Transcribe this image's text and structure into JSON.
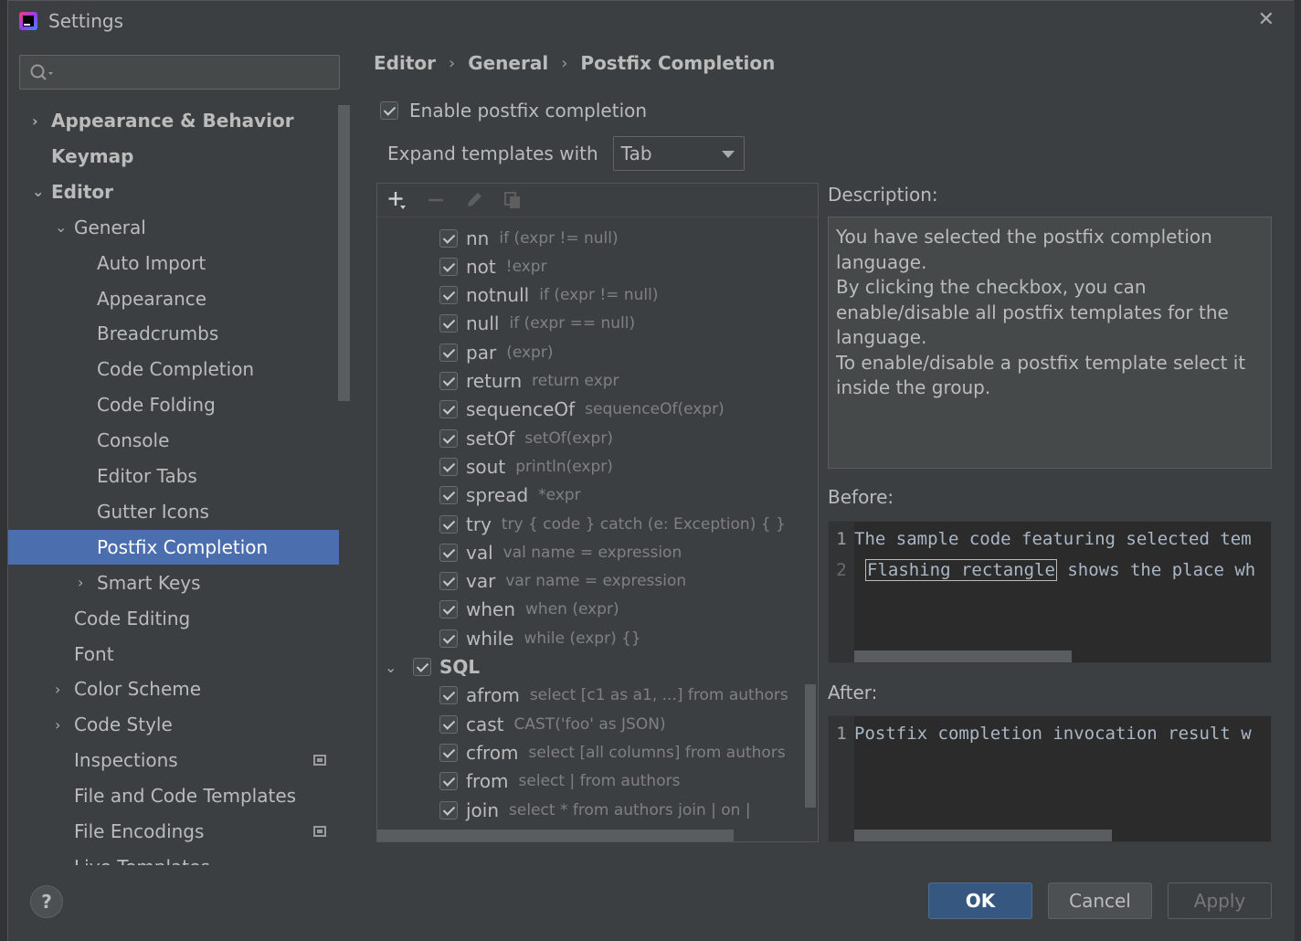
{
  "window": {
    "title": "Settings"
  },
  "search": {
    "placeholder": ""
  },
  "tree": [
    {
      "label": "Appearance & Behavior",
      "bold": true,
      "chevron": "›",
      "indent": 0
    },
    {
      "label": "Keymap",
      "bold": true,
      "chevron": "",
      "indent": 0
    },
    {
      "label": "Editor",
      "bold": true,
      "chevron": "⌄",
      "indent": 0
    },
    {
      "label": "General",
      "bold": false,
      "chevron": "⌄",
      "indent": 1
    },
    {
      "label": "Auto Import",
      "bold": false,
      "chevron": "",
      "indent": 2
    },
    {
      "label": "Appearance",
      "bold": false,
      "chevron": "",
      "indent": 2
    },
    {
      "label": "Breadcrumbs",
      "bold": false,
      "chevron": "",
      "indent": 2
    },
    {
      "label": "Code Completion",
      "bold": false,
      "chevron": "",
      "indent": 2
    },
    {
      "label": "Code Folding",
      "bold": false,
      "chevron": "",
      "indent": 2
    },
    {
      "label": "Console",
      "bold": false,
      "chevron": "",
      "indent": 2
    },
    {
      "label": "Editor Tabs",
      "bold": false,
      "chevron": "",
      "indent": 2
    },
    {
      "label": "Gutter Icons",
      "bold": false,
      "chevron": "",
      "indent": 2
    },
    {
      "label": "Postfix Completion",
      "bold": false,
      "chevron": "",
      "indent": 2,
      "selected": true
    },
    {
      "label": "Smart Keys",
      "bold": false,
      "chevron": "›",
      "indent": 2
    },
    {
      "label": "Code Editing",
      "bold": false,
      "chevron": "",
      "indent": 1
    },
    {
      "label": "Font",
      "bold": false,
      "chevron": "",
      "indent": 1
    },
    {
      "label": "Color Scheme",
      "bold": false,
      "chevron": "›",
      "indent": 1
    },
    {
      "label": "Code Style",
      "bold": false,
      "chevron": "›",
      "indent": 1
    },
    {
      "label": "Inspections",
      "bold": false,
      "chevron": "",
      "indent": 1,
      "project_icon": true
    },
    {
      "label": "File and Code Templates",
      "bold": false,
      "chevron": "",
      "indent": 1
    },
    {
      "label": "File Encodings",
      "bold": false,
      "chevron": "",
      "indent": 1,
      "project_icon": true
    },
    {
      "label": "Live Templates",
      "bold": false,
      "chevron": "",
      "indent": 1
    }
  ],
  "breadcrumb": [
    "Editor",
    "General",
    "Postfix Completion"
  ],
  "enable": {
    "checked": true,
    "label": "Enable postfix completion"
  },
  "expand": {
    "label": "Expand templates with",
    "value": "Tab"
  },
  "templates": [
    {
      "name": "nn",
      "desc": "if (expr != null)",
      "group": false
    },
    {
      "name": "not",
      "desc": "!expr",
      "group": false
    },
    {
      "name": "notnull",
      "desc": "if (expr != null)",
      "group": false
    },
    {
      "name": "null",
      "desc": "if (expr == null)",
      "group": false
    },
    {
      "name": "par",
      "desc": "(expr)",
      "group": false
    },
    {
      "name": "return",
      "desc": "return expr",
      "group": false
    },
    {
      "name": "sequenceOf",
      "desc": "sequenceOf(expr)",
      "group": false
    },
    {
      "name": "setOf",
      "desc": "setOf(expr)",
      "group": false
    },
    {
      "name": "sout",
      "desc": "println(expr)",
      "group": false
    },
    {
      "name": "spread",
      "desc": "*expr",
      "group": false
    },
    {
      "name": "try",
      "desc": "try { code } catch (e: Exception) { }",
      "group": false
    },
    {
      "name": "val",
      "desc": "val name = expression",
      "group": false
    },
    {
      "name": "var",
      "desc": "var name = expression",
      "group": false
    },
    {
      "name": "when",
      "desc": "when (expr)",
      "group": false
    },
    {
      "name": "while",
      "desc": "while (expr) {}",
      "group": false
    },
    {
      "name": "SQL",
      "desc": "",
      "group": true
    },
    {
      "name": "afrom",
      "desc": "select [c1 as a1, ...] from authors",
      "group": false
    },
    {
      "name": "cast",
      "desc": "CAST('foo' as JSON)",
      "group": false
    },
    {
      "name": "cfrom",
      "desc": "select [all columns] from authors",
      "group": false
    },
    {
      "name": "from",
      "desc": "select | from authors",
      "group": false
    },
    {
      "name": "join",
      "desc": "select * from authors join | on |",
      "group": false
    }
  ],
  "description": {
    "label": "Description:",
    "lines": [
      "You have selected the postfix completion",
      "language.",
      "By clicking the checkbox, you can",
      "enable/disable all postfix templates for the",
      "language.",
      "To enable/disable a postfix template select it",
      "inside the group."
    ]
  },
  "before": {
    "label": "Before:",
    "line1_num": "1",
    "line1": "The sample code featuring selected tem",
    "line2_num": "2",
    "line2_highlight": "Flashing rectangle",
    "line2_rest": " shows the place wh"
  },
  "after": {
    "label": "After:",
    "line1_num": "1",
    "line1": "Postfix completion invocation result w"
  },
  "buttons": {
    "ok": "OK",
    "cancel": "Cancel",
    "apply": "Apply",
    "help": "?"
  },
  "colors": {
    "selection": "#4b6eaf",
    "ok_button": "#365880",
    "panel": "#3c3f41"
  }
}
